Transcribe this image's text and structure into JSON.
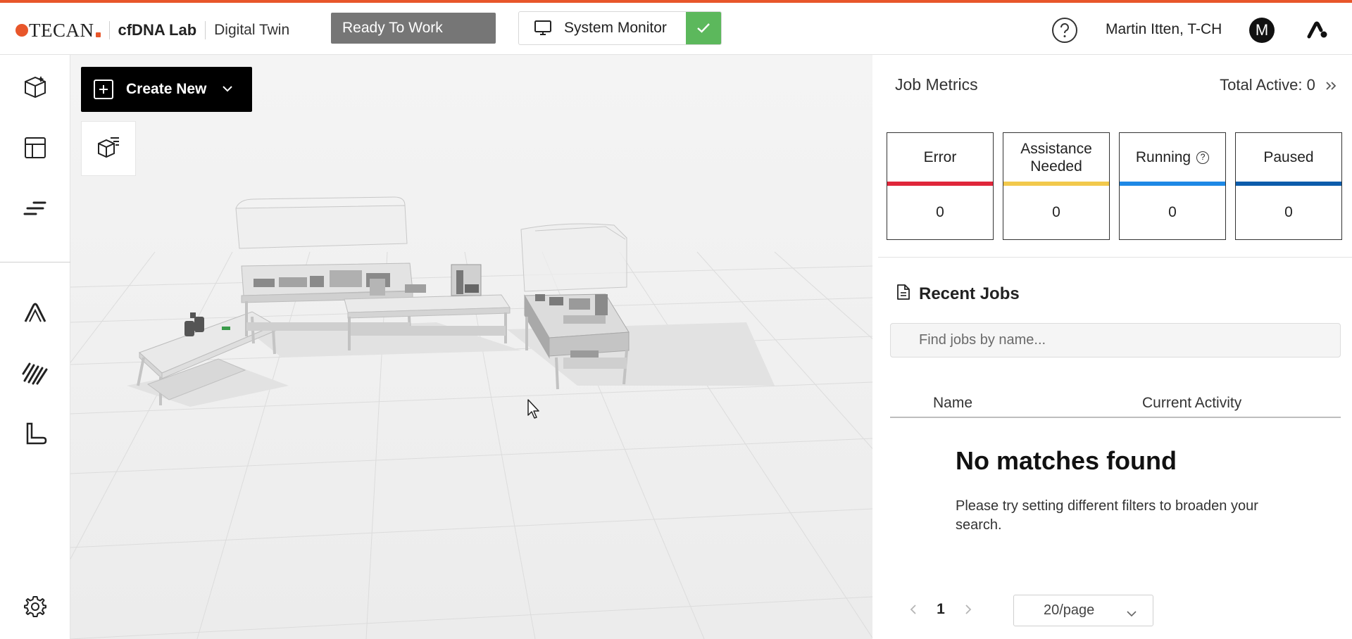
{
  "header": {
    "brand": "TECAN",
    "lab_name": "cfDNA Lab",
    "view_name": "Digital Twin",
    "status_button": "Ready To Work",
    "system_monitor_label": "System Monitor",
    "user_name": "Martin Itten, T-CH",
    "user_initial": "M"
  },
  "sidebar": {
    "items": [
      {
        "name": "3d-cube-icon"
      },
      {
        "name": "layout-icon"
      },
      {
        "name": "sort-lines-icon"
      },
      {
        "name": "triangle-app-icon"
      },
      {
        "name": "stripes-app-icon"
      },
      {
        "name": "bench-icon"
      },
      {
        "name": "gear-icon"
      }
    ]
  },
  "viewport": {
    "create_button": "Create New",
    "layer_button_icon": "cube-list-icon"
  },
  "metrics": {
    "title": "Job Metrics",
    "total_active": "Total Active: 0",
    "cards": [
      {
        "label": "Error",
        "value": "0",
        "color": "#e0263a"
      },
      {
        "label": "Assistance Needed",
        "value": "0",
        "color": "#f2c94c"
      },
      {
        "label": "Running",
        "value": "0",
        "color": "#1e88e5"
      },
      {
        "label": "Paused",
        "value": "0",
        "color": "#0d5cab"
      }
    ]
  },
  "recent_jobs": {
    "title": "Recent Jobs",
    "search_placeholder": "Find jobs by name...",
    "columns": [
      "Name",
      "Current Activity"
    ],
    "empty_title": "No matches found",
    "empty_text": "Please try setting different filters to broaden your search."
  },
  "pagination": {
    "current_page": "1",
    "page_size": "20/page"
  },
  "colors": {
    "accent": "#e8562a",
    "status_button": "#767676",
    "ok_green": "#5cb85c"
  }
}
